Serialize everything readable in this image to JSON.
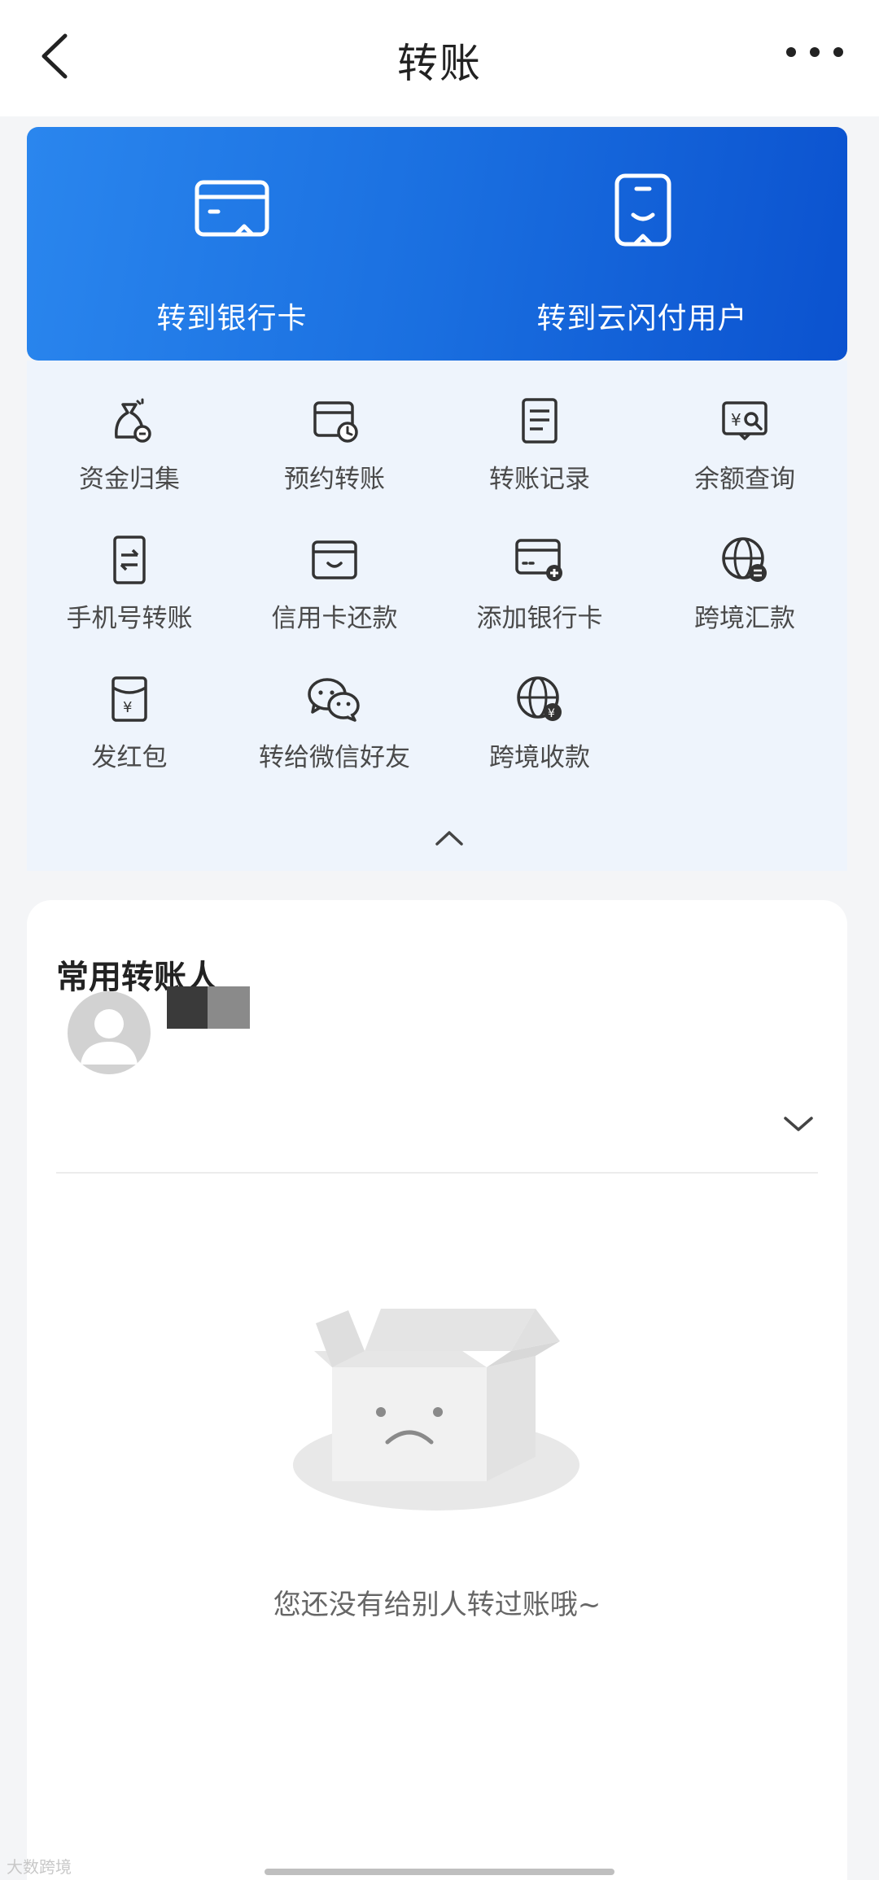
{
  "header": {
    "title": "转账",
    "back_icon": "chevron-left-icon",
    "more_icon": "more-dots-icon"
  },
  "banner": {
    "left": {
      "label": "转到银行卡",
      "icon": "bank-card-icon"
    },
    "right": {
      "label": "转到云闪付用户",
      "icon": "phone-user-icon"
    },
    "colors": {
      "start": "#2a86ee",
      "end": "#0b52cf"
    }
  },
  "shortcuts": [
    {
      "label": "资金归集",
      "icon": "money-bag-icon"
    },
    {
      "label": "预约转账",
      "icon": "scheduled-transfer-icon"
    },
    {
      "label": "转账记录",
      "icon": "records-icon"
    },
    {
      "label": "余额查询",
      "icon": "balance-query-icon"
    },
    {
      "label": "手机号转账",
      "icon": "phone-transfer-icon"
    },
    {
      "label": "信用卡还款",
      "icon": "credit-card-icon"
    },
    {
      "label": "添加银行卡",
      "icon": "add-card-icon"
    },
    {
      "label": "跨境汇款",
      "icon": "cross-border-remit-icon"
    },
    {
      "label": "发红包",
      "icon": "red-packet-icon"
    },
    {
      "label": "转给微信好友",
      "icon": "wechat-icon"
    },
    {
      "label": "跨境收款",
      "icon": "cross-border-receive-icon"
    }
  ],
  "frequent": {
    "title": "常用转账人",
    "empty_text": "您还没有给别人转过账哦~"
  },
  "watermark": "大数跨境"
}
